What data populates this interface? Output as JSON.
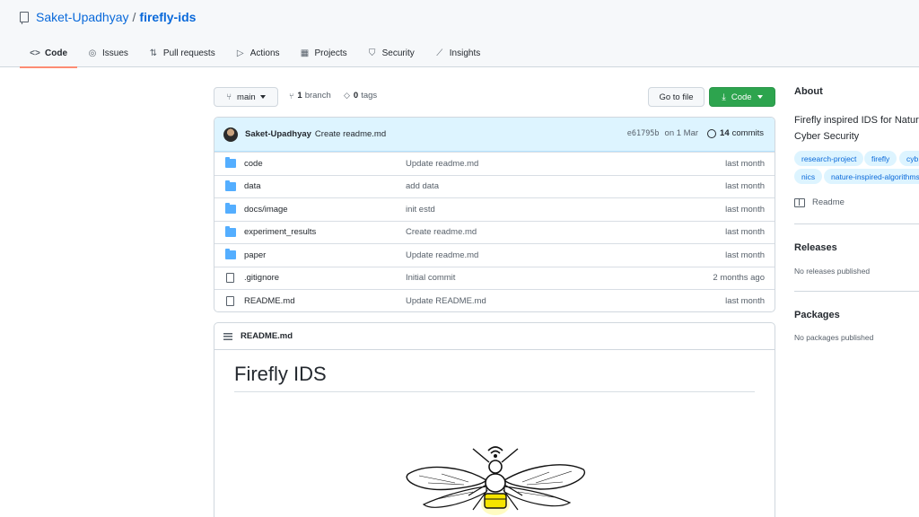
{
  "repo": {
    "owner": "Saket-Upadhyay",
    "separator": "/",
    "name": "firefly-ids"
  },
  "tabs": [
    {
      "label": "Code",
      "icon": "code-icon",
      "active": true
    },
    {
      "label": "Issues",
      "icon": "issue-icon"
    },
    {
      "label": "Pull requests",
      "icon": "pull-request-icon"
    },
    {
      "label": "Actions",
      "icon": "play-icon"
    },
    {
      "label": "Projects",
      "icon": "project-icon"
    },
    {
      "label": "Security",
      "icon": "shield-icon"
    },
    {
      "label": "Insights",
      "icon": "graph-icon"
    }
  ],
  "branch_bar": {
    "branch": "main",
    "branches_count": "1",
    "branches_label": "branch",
    "tags_count": "0",
    "tags_label": "tags",
    "goto_label": "Go to file",
    "code_label": "Code"
  },
  "commit": {
    "author": "Saket-Upadhyay",
    "message": "Create readme.md",
    "hash": "e61795b",
    "date": "on 1 Mar",
    "count": "14",
    "count_label": "commits"
  },
  "files": [
    {
      "name": "code",
      "type": "folder",
      "message": "Update readme.md",
      "date": "last month"
    },
    {
      "name": "data",
      "type": "folder",
      "message": "add data",
      "date": "last month"
    },
    {
      "name": "docs/image",
      "type": "folder",
      "message": "init estd",
      "date": "last month"
    },
    {
      "name": "experiment_results",
      "type": "folder",
      "message": "Create readme.md",
      "date": "last month"
    },
    {
      "name": "paper",
      "type": "folder",
      "message": "Update readme.md",
      "date": "last month"
    },
    {
      "name": ".gitignore",
      "type": "file",
      "message": "Initial commit",
      "date": "2 months ago"
    },
    {
      "name": "README.md",
      "type": "file",
      "message": "Update README.md",
      "date": "last month"
    }
  ],
  "readme": {
    "filename": "README.md",
    "title": "Firefly IDS"
  },
  "about": {
    "heading": "About",
    "desc_line1": "Firefly inspired IDS for Natur",
    "desc_line2": "Cyber Security",
    "topics": [
      "research-project",
      "firefly",
      "cyb",
      "nics",
      "nature-inspired-algorithms"
    ],
    "readme_label": "Readme"
  },
  "releases": {
    "heading": "Releases",
    "note": "No releases published"
  },
  "packages": {
    "heading": "Packages",
    "note": "No packages published"
  },
  "colors": {
    "accent": "#0969da",
    "code_button": "#2da44e",
    "folder": "#54aeff",
    "commit_bar": "#ddf4ff",
    "active_tab_underline": "#fd8c73"
  }
}
